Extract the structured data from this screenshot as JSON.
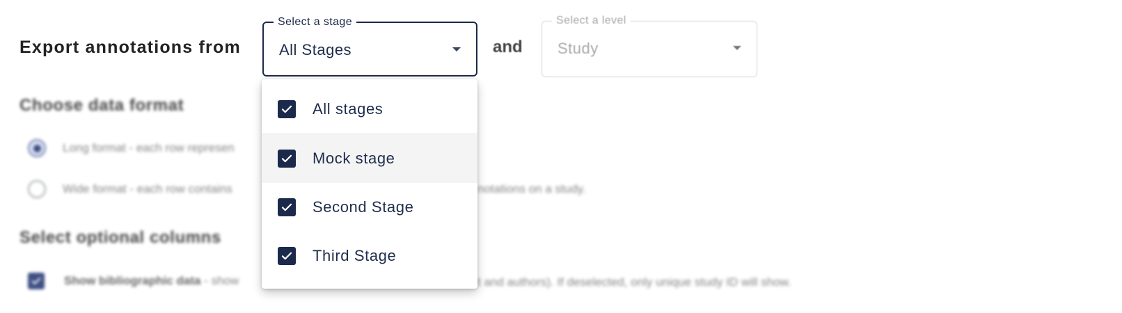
{
  "header": {
    "heading": "Export annotations from",
    "connector": "and"
  },
  "stage_select": {
    "legend": "Select a stage",
    "value": "All Stages"
  },
  "level_select": {
    "legend": "Select a level",
    "value": "Study"
  },
  "stage_menu": {
    "items": [
      {
        "label": "All stages",
        "checked": true
      },
      {
        "label": "Mock stage",
        "checked": true
      },
      {
        "label": "Second Stage",
        "checked": true
      },
      {
        "label": "Third Stage",
        "checked": true
      }
    ]
  },
  "data_format": {
    "title": "Choose data format",
    "options": [
      {
        "label": "Long format - each row represen",
        "selected": true
      },
      {
        "label": "Wide format - each row contains",
        "suffix": "notations on a study.",
        "selected": false
      }
    ]
  },
  "optional_columns": {
    "title": "Select optional columns",
    "bibliographic": {
      "label_bold": "Show bibliographic data",
      "label_rest": " - show",
      "suffix": "t and authors). If deselected, only unique study ID will show."
    }
  },
  "colors": {
    "accent": "#1b2a4a",
    "radio_accent": "#2a3d78"
  }
}
